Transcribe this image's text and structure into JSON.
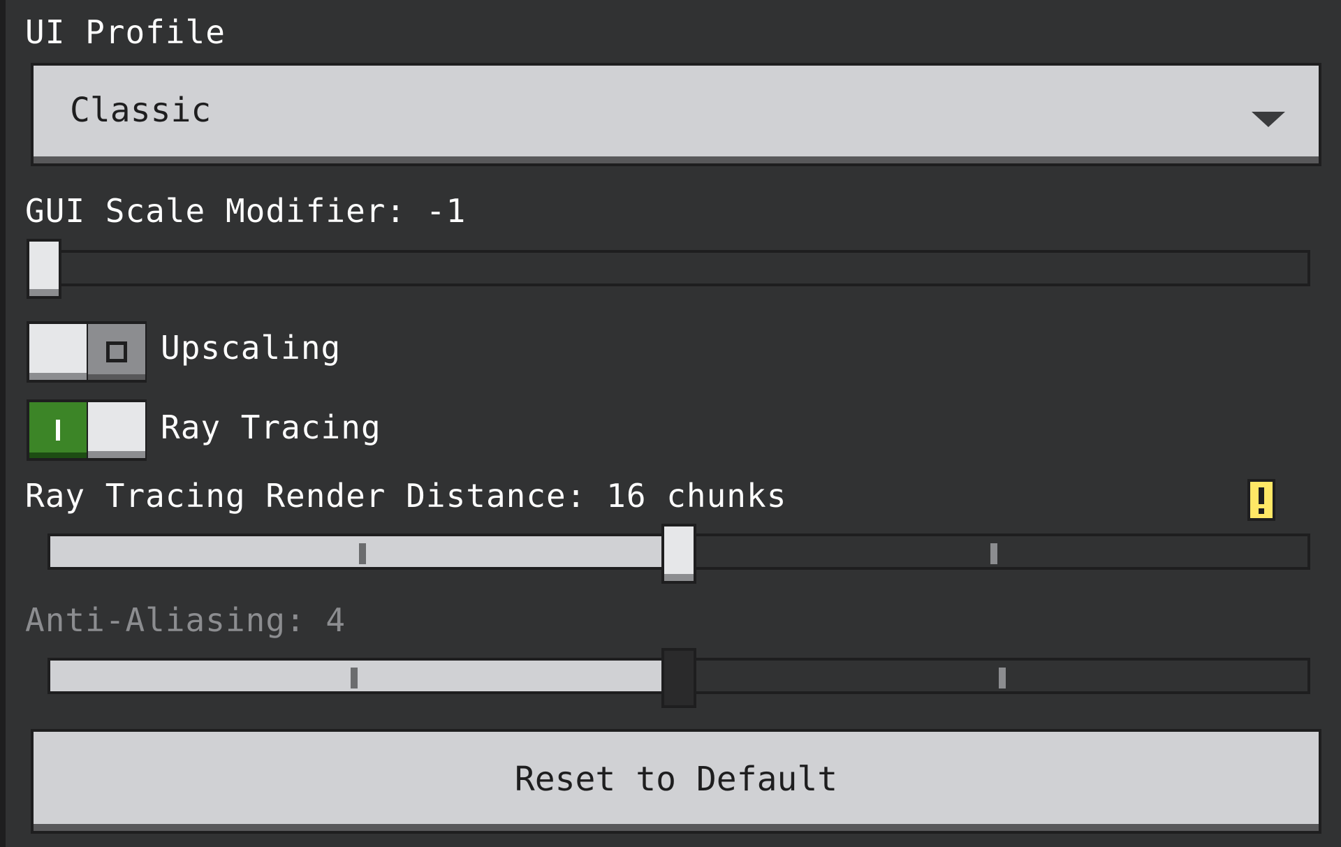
{
  "ui_profile": {
    "label": "UI Profile",
    "selected": "Classic"
  },
  "gui_scale": {
    "label": "GUI Scale Modifier: -1",
    "value": -1,
    "fraction": 0.0
  },
  "upscaling": {
    "label": "Upscaling",
    "on": false
  },
  "ray_tracing": {
    "label": "Ray Tracing",
    "on": true
  },
  "rt_render_distance": {
    "label": "Ray Tracing Render Distance: 16 chunks",
    "value_chunks": 16,
    "fraction": 0.5,
    "warning_icon": "warning-icon"
  },
  "anti_aliasing": {
    "label": "Anti-Aliasing: 4",
    "value": 4,
    "fraction": 0.5,
    "disabled": true
  },
  "reset": {
    "label": "Reset to Default"
  },
  "colors": {
    "background": "#313233",
    "control_light": "#d0d1d4",
    "toggle_on": "#3c8527",
    "warning": "#ffe866",
    "disabled_text": "#8c8d90"
  }
}
